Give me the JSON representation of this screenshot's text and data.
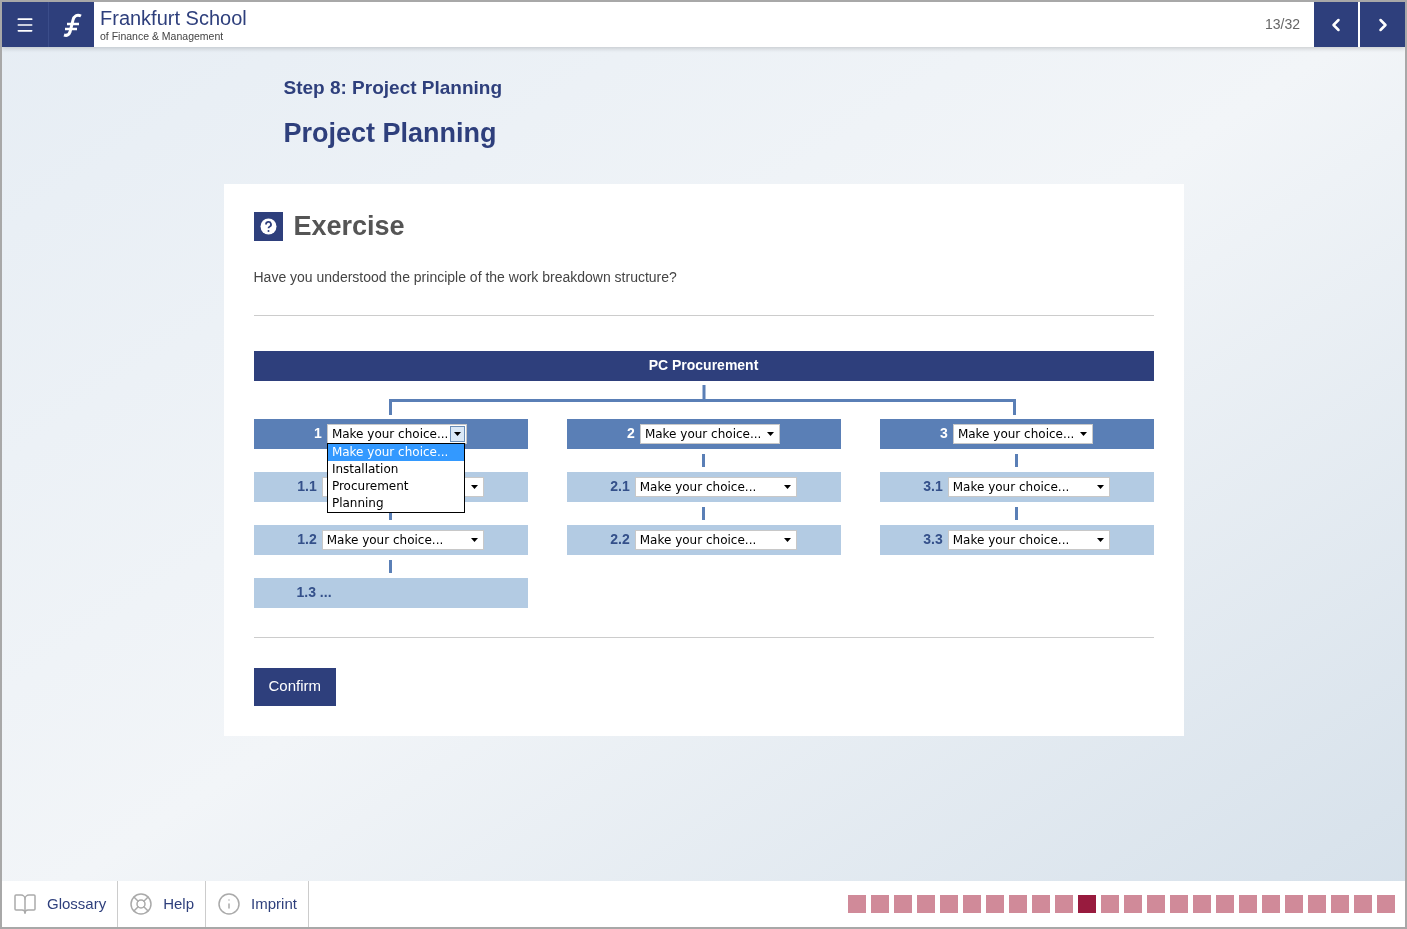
{
  "header": {
    "brand_name": "Frankfurt School",
    "brand_subtitle": "of Finance & Management",
    "page_counter": "13/32"
  },
  "page": {
    "step": "Step 8: Project Planning",
    "title": "Project Planning"
  },
  "exercise": {
    "heading": "Exercise",
    "question": "Have you understood the principle of the work breakdown structure?",
    "chart_title": "PC Procurement",
    "columns": [
      {
        "number": "1",
        "kind": "select",
        "value": "Make your choice...",
        "expanded": true,
        "options": [
          {
            "label": "Make your choice...",
            "selected": true
          },
          {
            "label": "Installation",
            "selected": false
          },
          {
            "label": "Procurement",
            "selected": false
          },
          {
            "label": "Planning",
            "selected": false
          }
        ],
        "children": [
          {
            "number": "1.1",
            "kind": "select",
            "expanded": false
          },
          {
            "number": "1.2",
            "kind": "select",
            "value": "Make your choice...",
            "expanded": false
          },
          {
            "number": "1.3 ...",
            "kind": "text"
          }
        ]
      },
      {
        "number": "2",
        "kind": "select",
        "value": "Make your choice...",
        "expanded": false,
        "children": [
          {
            "number": "2.1",
            "kind": "select",
            "value": "Make your choice...",
            "expanded": false
          },
          {
            "number": "2.2",
            "kind": "select",
            "value": "Make your choice...",
            "expanded": false
          }
        ]
      },
      {
        "number": "3",
        "kind": "select",
        "value": "Make your choice...",
        "expanded": false,
        "children": [
          {
            "number": "3.1",
            "kind": "select",
            "value": "Make your choice...",
            "expanded": false
          },
          {
            "number": "3.3",
            "kind": "select",
            "value": "Make your choice...",
            "expanded": false
          }
        ]
      }
    ],
    "confirm_button": "Confirm"
  },
  "footer": {
    "links": [
      {
        "label": "Glossary",
        "kind": "book"
      },
      {
        "label": "Help",
        "kind": "lifebuoy"
      },
      {
        "label": "Imprint",
        "kind": "info"
      }
    ],
    "progress": [
      {
        "selected": false
      },
      {
        "selected": false
      },
      {
        "selected": false
      },
      {
        "selected": false
      },
      {
        "selected": false
      },
      {
        "selected": false
      },
      {
        "selected": false
      },
      {
        "selected": false
      },
      {
        "selected": false
      },
      {
        "selected": false
      },
      {
        "selected": true
      },
      {
        "selected": false
      },
      {
        "selected": false
      },
      {
        "selected": false
      },
      {
        "selected": false
      },
      {
        "selected": false
      },
      {
        "selected": false
      },
      {
        "selected": false
      },
      {
        "selected": false
      },
      {
        "selected": false
      },
      {
        "selected": false
      },
      {
        "selected": false
      },
      {
        "selected": false
      },
      {
        "selected": false
      }
    ]
  }
}
